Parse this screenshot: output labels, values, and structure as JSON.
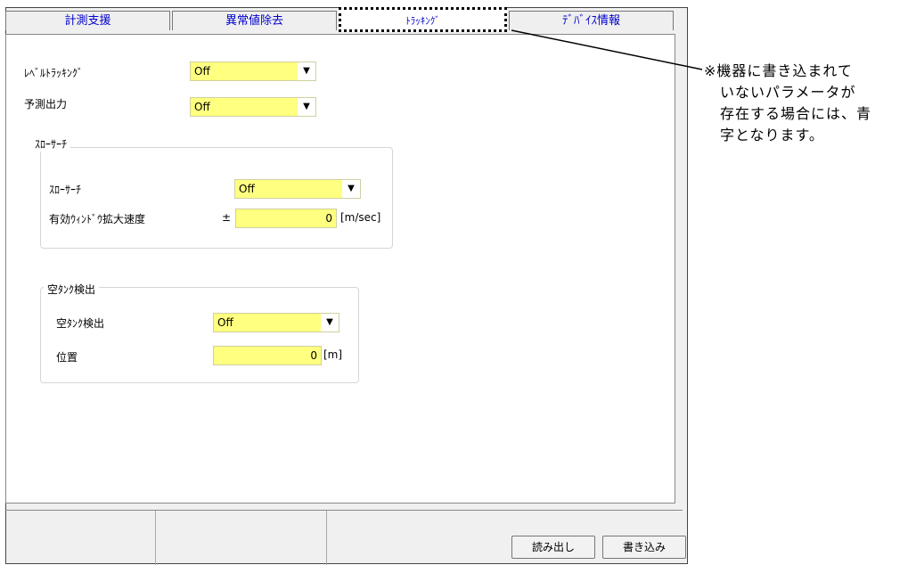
{
  "tabs": [
    {
      "label": "計測支援"
    },
    {
      "label": "異常値除去"
    },
    {
      "label": "ﾄﾗｯｷﾝｸﾞ"
    },
    {
      "label": "ﾃﾞﾊﾞｲｽ情報"
    }
  ],
  "fields": {
    "level_tracking": {
      "label": "ﾚﾍﾞﾙﾄﾗｯｷﾝｸﾞ",
      "value": "Off"
    },
    "prediction_output": {
      "label": "予測出力",
      "value": "Off"
    }
  },
  "slow_search": {
    "title": "ｽﾛｰｻｰﾁ",
    "mode": {
      "label": "ｽﾛｰｻｰﾁ",
      "value": "Off"
    },
    "window_speed": {
      "label": "有効ｳｨﾝﾄﾞｳ拡大速度",
      "prefix": "±",
      "value": "0",
      "unit": "[m/sec]"
    }
  },
  "empty_tank": {
    "title": "空ﾀﾝｸ検出",
    "mode": {
      "label": "空ﾀﾝｸ検出",
      "value": "Off"
    },
    "position": {
      "label": "位置",
      "value": "0",
      "unit": "[m]"
    }
  },
  "buttons": {
    "read": "読み出し",
    "write": "書き込み"
  },
  "note": {
    "lines": [
      "※機器に書き込まれて",
      "いないパラメータが",
      "存在する場合には、青",
      "字となります。"
    ]
  }
}
